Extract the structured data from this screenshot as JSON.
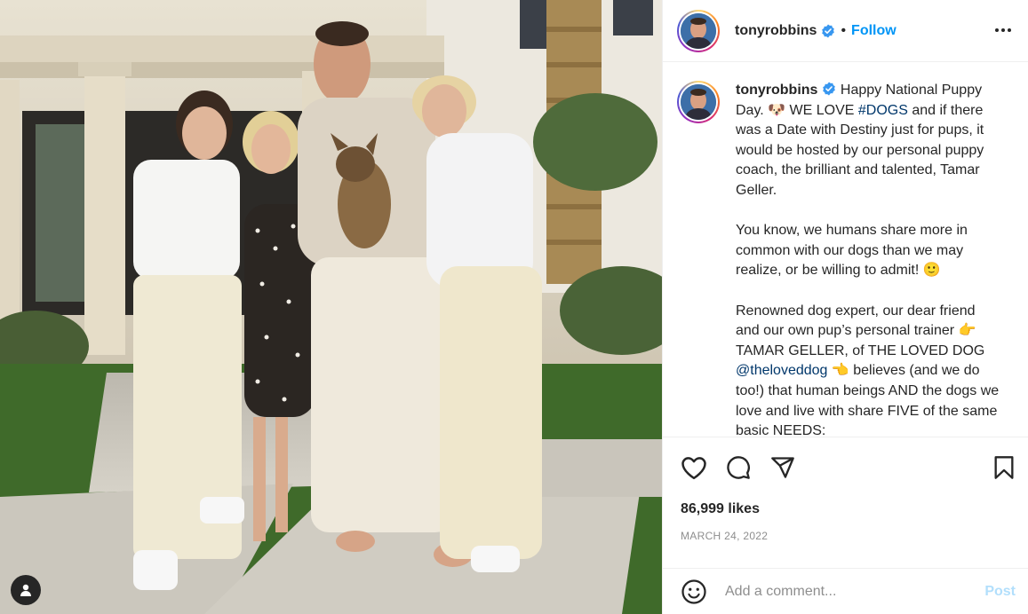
{
  "post": {
    "username": "tonyrobbins",
    "follow_label": "Follow",
    "separator": "•",
    "caption": {
      "line1_text": "Happy National Puppy Day. 🐶 WE LOVE ",
      "hashtag": "#DOGS",
      "line1_rest": " and if there was a Date with Destiny just for pups, it would be hosted by our personal puppy coach, the brilliant and talented, Tamar Geller.",
      "para2": "You know, we humans share more in common with our dogs than we may realize, or be willing to admit! 🙂",
      "para3_a": "Renowned dog expert, our dear friend and our own pup’s personal trainer 👉 TAMAR GELLER, of THE LOVED DOG ",
      "mention": "@theloveddog",
      "para3_b": " 👈 believes (and we do too!) that human beings AND the dogs we love and live with share FIVE of the same basic NEEDS:"
    },
    "likes_text": "86,999 likes",
    "date_text": "MARCH 24, 2022",
    "comment_placeholder": "Add a comment...",
    "post_label": "Post"
  },
  "icons": {
    "verified": "verified-badge-icon",
    "more": "more-options-icon",
    "like": "heart-icon",
    "comment": "comment-icon",
    "share": "share-icon",
    "save": "bookmark-icon",
    "emoji": "emoji-icon",
    "tag": "user-tag-icon"
  },
  "colors": {
    "accent": "#0095f6",
    "verified": "#3897f0",
    "link": "#00376b",
    "muted": "#8e8e8e",
    "post_disabled": "#b2dffc"
  }
}
